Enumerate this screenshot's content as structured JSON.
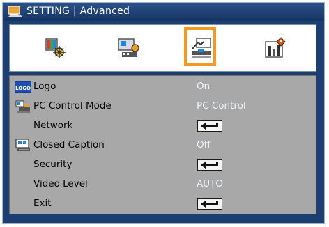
{
  "title": "SETTING | Advanced",
  "tabs": [
    {
      "icon": "image-settings-icon",
      "active": false
    },
    {
      "icon": "display-settings-icon",
      "active": false
    },
    {
      "icon": "setting-advanced-icon",
      "active": true
    },
    {
      "icon": "options-icon",
      "active": false
    }
  ],
  "menu": {
    "items": [
      {
        "label": "Logo",
        "value": "On",
        "icon": "logo-icon",
        "type": "value"
      },
      {
        "label": "PC Control Mode",
        "value": "PC Control",
        "icon": "pc-control-icon",
        "type": "value"
      },
      {
        "label": "Network",
        "value": "",
        "icon": "",
        "type": "enter"
      },
      {
        "label": "Closed Caption",
        "value": "Off",
        "icon": "closed-caption-icon",
        "type": "value"
      },
      {
        "label": "Security",
        "value": "",
        "icon": "",
        "type": "enter"
      },
      {
        "label": "Video Level",
        "value": "AUTO",
        "icon": "",
        "type": "value"
      },
      {
        "label": "Exit",
        "value": "",
        "icon": "",
        "type": "enter"
      }
    ]
  },
  "colors": {
    "frame": "#1c3f72",
    "highlight": "#f39a1f",
    "panel": "#a8a8a8",
    "value_text": "#eef3fb"
  },
  "icons": {
    "logo_badge_text": "LOGO"
  }
}
